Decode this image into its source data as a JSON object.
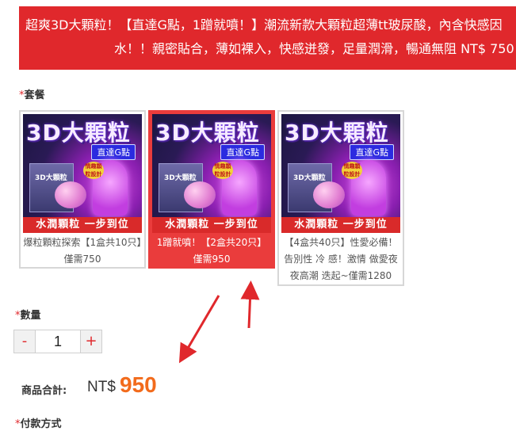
{
  "banner": {
    "line1": "超爽3D大顆粒！【直達G點，1蹭就噴！】潮流新款大顆粒超薄tt玻尿酸，內含快感因",
    "line2": "水！！親密貼合，薄如裸入，快感迸發，足量潤滑，暢通無阻 NT$ 750"
  },
  "package": {
    "required_mark": "*",
    "label": "套餐",
    "product_art": {
      "title": "3D大顆粒",
      "tag": "直達G點",
      "box_text": "3D大顆粒",
      "badge": "情趣顆粒設計",
      "strip": "水潤顆粒 一步到位"
    },
    "options": [
      {
        "caption": "爆粒顆粒探索【1盒共10只】僅需750",
        "selected": false
      },
      {
        "caption": "1蹭就噴！【2盒共20只】僅需950",
        "selected": true
      },
      {
        "caption": "【4盒共40只】性愛必備！告別性 冷 感！激情 做愛夜夜高潮 迭起~僅需1280",
        "selected": false
      }
    ]
  },
  "quantity": {
    "required_mark": "*",
    "label": "數量",
    "minus": "-",
    "value": "1",
    "plus": "+"
  },
  "total": {
    "label": "商品合計:",
    "currency": "NT$",
    "amount": "950"
  },
  "payment": {
    "required_mark": "*",
    "label": "付款方式"
  },
  "colors": {
    "accent_red": "#e0282c",
    "selected_bg": "#ea3c3c",
    "total_orange": "#f26b1c"
  }
}
